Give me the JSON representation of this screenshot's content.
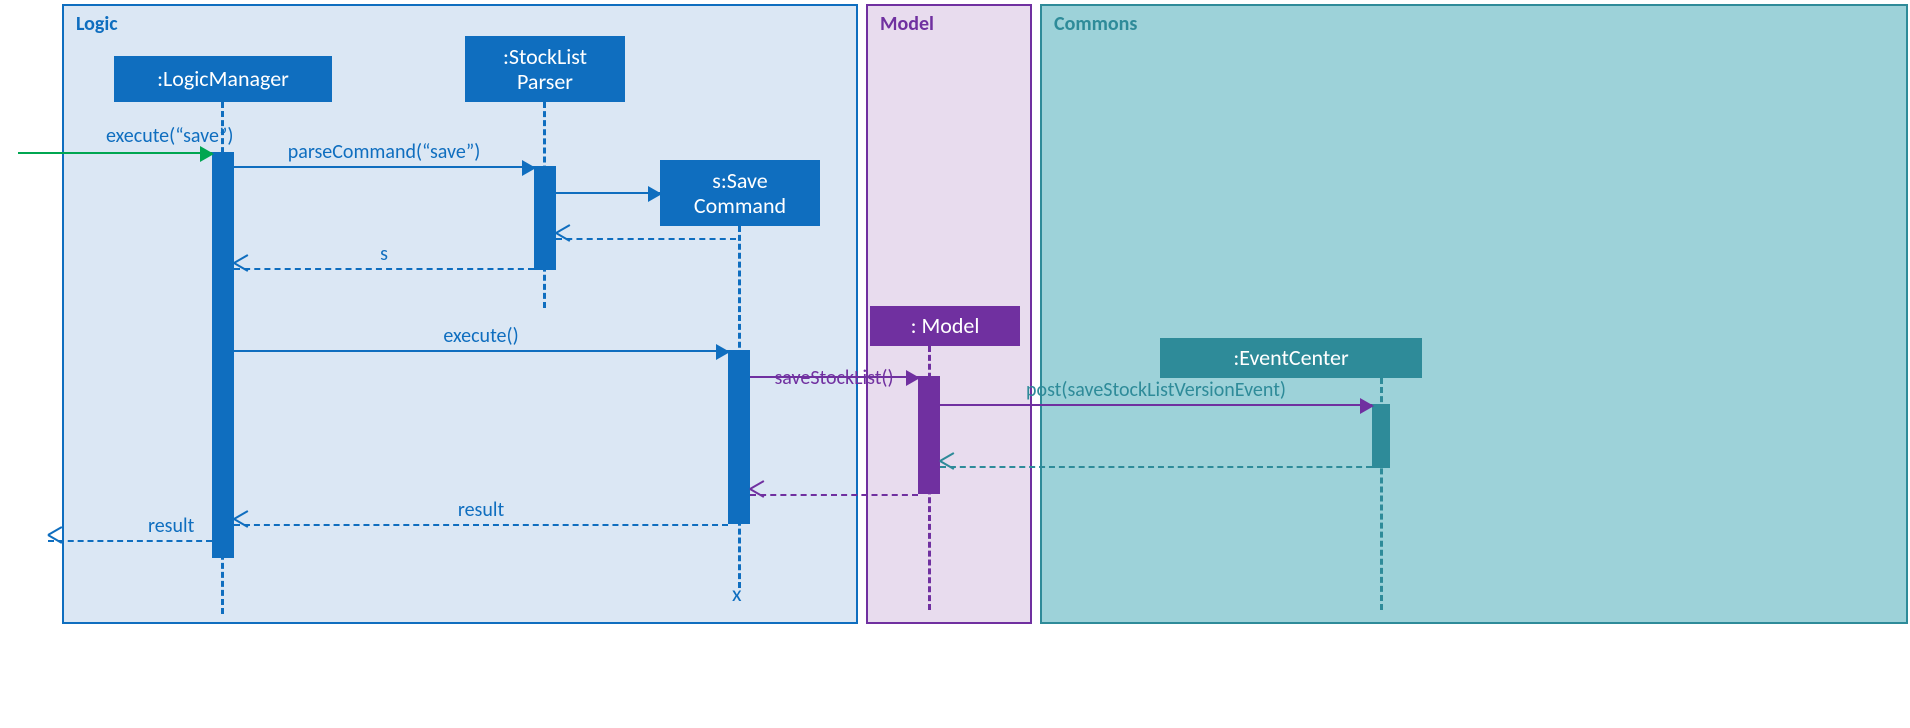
{
  "modules": {
    "logic": "Logic",
    "model": "Model",
    "commons": "Commons"
  },
  "participants": {
    "logicManager": ":LogicManager",
    "stockListParser": ":StockList Parser",
    "saveCommand": "s:Save Command",
    "model": ": Model",
    "eventCenter": ":EventCenter"
  },
  "messages": {
    "execute_save": "execute(“save”)",
    "parseCommand": "parseCommand(“save”)",
    "return_s": "s",
    "execute": "execute()",
    "saveStockList": "saveStockList()",
    "postEvent": "post(saveStockListVersionEvent)",
    "result": "result",
    "result_out": "result"
  },
  "destroy": "x"
}
